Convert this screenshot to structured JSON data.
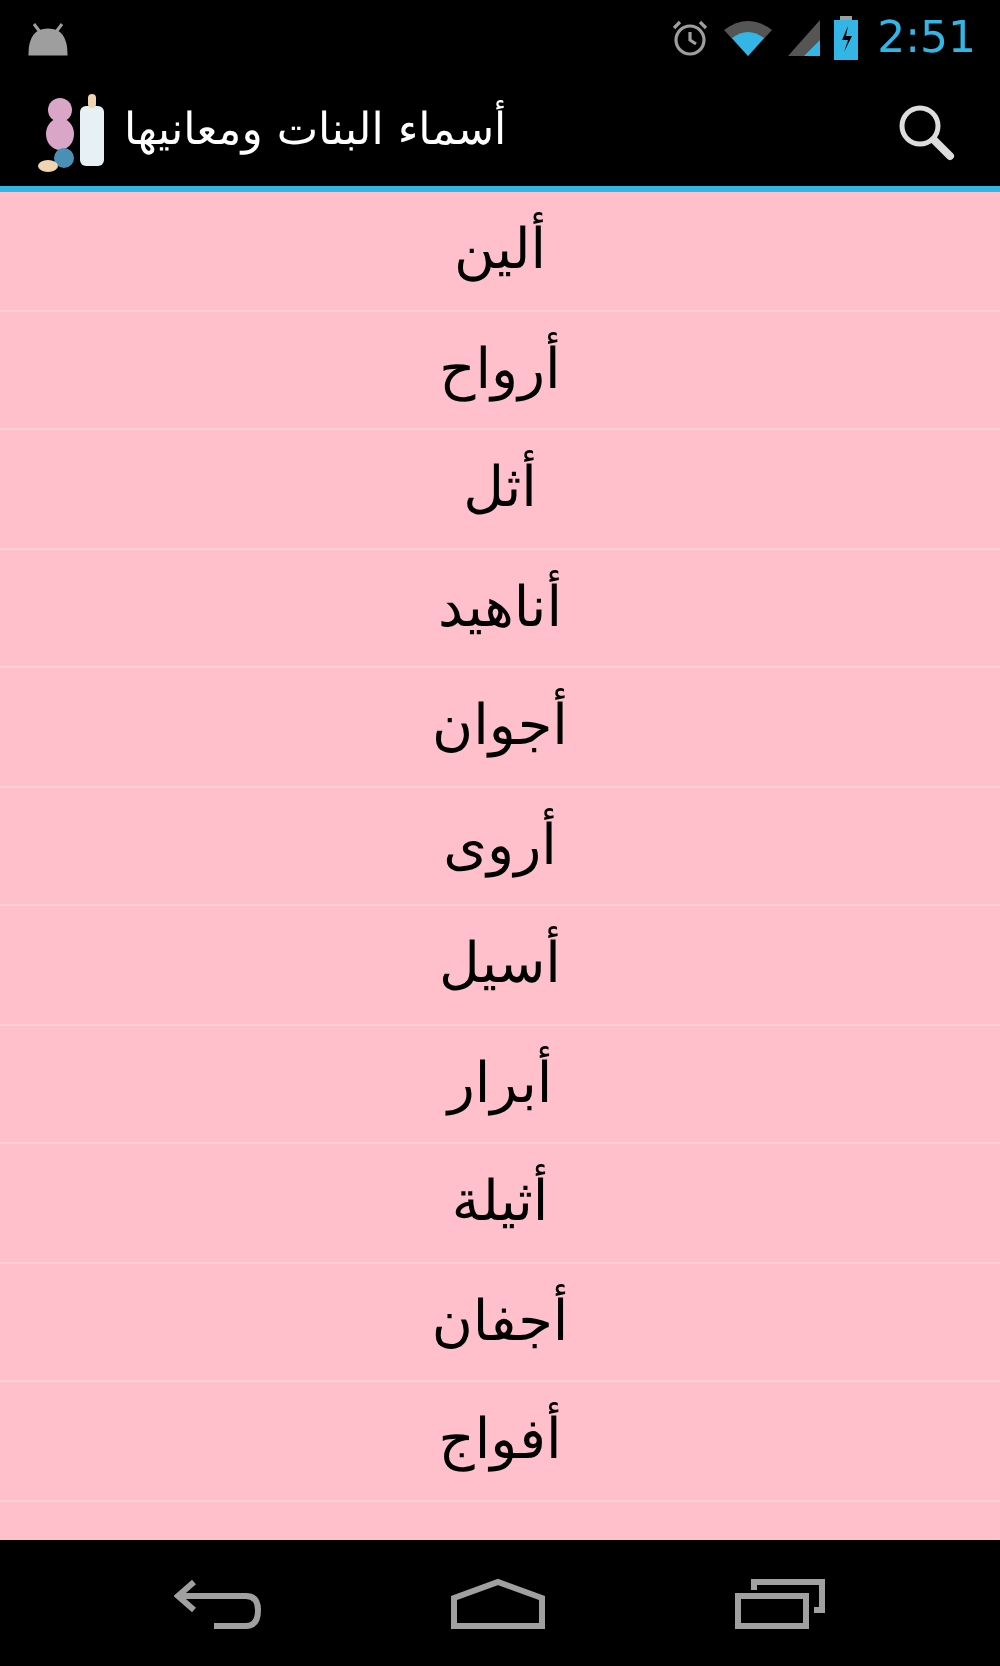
{
  "status_bar": {
    "time": "2:51"
  },
  "action_bar": {
    "title": "أسماء البنات ومعانيها"
  },
  "names": [
    "ألين",
    "أرواح",
    "أثل",
    "أناهيد",
    "أجوان",
    "أروى",
    "أسيل",
    "أبرار",
    "أثيلة",
    "أجفان",
    "أفواج"
  ]
}
